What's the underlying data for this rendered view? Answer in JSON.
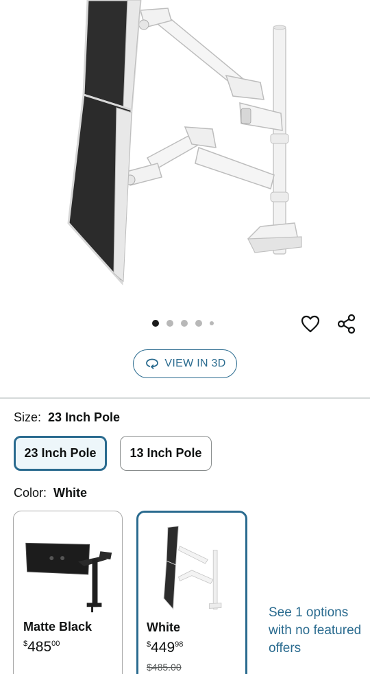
{
  "product_image": {
    "alt": "Dual monitor arm on white pole",
    "slide_count": 5,
    "active_slide": 1
  },
  "actions": {
    "wishlist_icon": "heart-icon",
    "share_icon": "share-icon"
  },
  "view3d": {
    "label": "VIEW IN 3D",
    "icon": "rotate-3d-icon"
  },
  "size": {
    "label": "Size:",
    "selected": "23 Inch Pole",
    "options": [
      {
        "label": "23 Inch Pole",
        "selected": true
      },
      {
        "label": "13 Inch Pole",
        "selected": false
      }
    ]
  },
  "color": {
    "label": "Color:",
    "selected": "White",
    "options": [
      {
        "name": "Matte Black",
        "price_symbol": "$",
        "price_whole": "485",
        "price_fraction": "00",
        "list_price": "",
        "selected": false
      },
      {
        "name": "White",
        "price_symbol": "$",
        "price_whole": "449",
        "price_fraction": "98",
        "list_price": "$485.00",
        "selected": true
      }
    ],
    "see_options": "See 1 options with no featured offers"
  },
  "colors": {
    "accent": "#2a6b8f",
    "selected_bg": "#edf6fa",
    "divider": "#d5d9d9",
    "text": "#0f1111"
  }
}
